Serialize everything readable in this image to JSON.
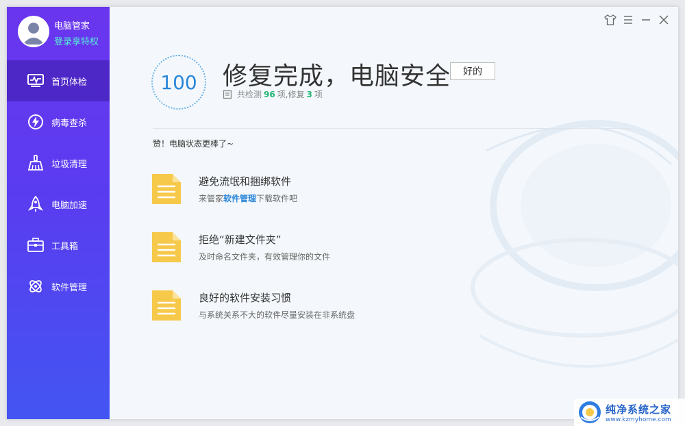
{
  "profile": {
    "name": "电脑管家",
    "link": "登录享特权"
  },
  "nav": [
    {
      "label": "首页体检",
      "icon": "monitor-icon",
      "active": true
    },
    {
      "label": "病毒查杀",
      "icon": "lightning-shield-icon",
      "active": false
    },
    {
      "label": "垃圾清理",
      "icon": "broom-icon",
      "active": false
    },
    {
      "label": "电脑加速",
      "icon": "rocket-icon",
      "active": false
    },
    {
      "label": "工具箱",
      "icon": "toolbox-icon",
      "active": false
    },
    {
      "label": "软件管理",
      "icon": "software-icon",
      "active": false
    }
  ],
  "title_controls": [
    "skin-icon",
    "menu-icon",
    "minimize-icon",
    "close-icon"
  ],
  "result": {
    "score": "100",
    "headline": "修复完成，电脑安全",
    "badge": "好的",
    "stats_prefix": "共检测",
    "checked": "96",
    "stats_mid": "项,修复",
    "fixed": "3",
    "stats_suffix": "项"
  },
  "praise": "赞！电脑状态更棒了~",
  "tips": [
    {
      "title": "避免流氓和捆绑软件",
      "desc_before": "来管家",
      "desc_link": "软件管理",
      "desc_after": "下载软件吧"
    },
    {
      "title": "拒绝“新建文件夹”",
      "desc_before": "及时命名文件夹，有效管理你的文件",
      "desc_link": "",
      "desc_after": ""
    },
    {
      "title": "良好的软件安装习惯",
      "desc_before": "与系统关系不大的软件尽量安装在非系统盘",
      "desc_link": "",
      "desc_after": ""
    }
  ],
  "watermark": {
    "title": "纯净系统之家",
    "url": "www.kzmyhome.com"
  },
  "colors": {
    "sidebar_top": "#6a35ee",
    "sidebar_bottom": "#4355f2",
    "accent_blue": "#2a86d9",
    "green_count": "#22b573",
    "link_cyan": "#55f0d6",
    "doc_yellow": "#f7c94b"
  }
}
